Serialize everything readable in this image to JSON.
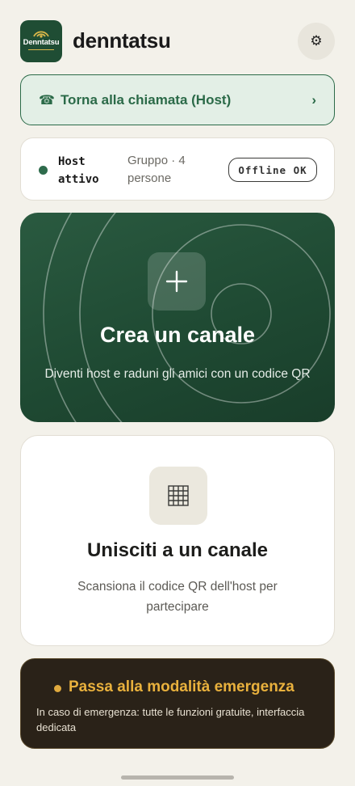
{
  "app": {
    "logo_text": "Denntatsu",
    "title": "denntatsu",
    "settings_icon": "gear-icon"
  },
  "call_banner": {
    "icon": "phone-icon",
    "label": "Torna alla chiamata (Host)",
    "chevron": "›"
  },
  "status": {
    "role": "Host attivo",
    "group": "Gruppo · 4 persone",
    "badge": "Offline OK",
    "dot_color": "#2e6b4c"
  },
  "create_card": {
    "icon": "plus-icon",
    "title": "Crea un canale",
    "subtitle": "Diventi host e raduni gli amici con un codice QR"
  },
  "join_card": {
    "icon": "qr-grid-icon",
    "title": "Unisciti a un canale",
    "subtitle": "Scansiona il codice QR dell'host per partecipare"
  },
  "emergency": {
    "title": "Passa alla modalità emergenza",
    "subtitle": "In caso di emergenza: tutte le funzioni gratuite, interfaccia dedicata",
    "accent": "#e9b13d"
  },
  "colors": {
    "brand_green": "#1f4d34",
    "background": "#f3f1ea"
  }
}
